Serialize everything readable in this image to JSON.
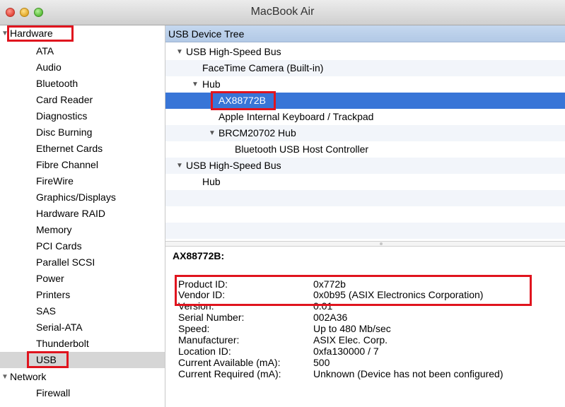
{
  "window": {
    "title": "MacBook Air"
  },
  "sidebar": {
    "groups": [
      {
        "label": "Hardware",
        "expanded": true
      },
      {
        "label": "Network",
        "expanded": true
      }
    ],
    "items": [
      "ATA",
      "Audio",
      "Bluetooth",
      "Card Reader",
      "Diagnostics",
      "Disc Burning",
      "Ethernet Cards",
      "Fibre Channel",
      "FireWire",
      "Graphics/Displays",
      "Hardware RAID",
      "Memory",
      "PCI Cards",
      "Parallel SCSI",
      "Power",
      "Printers",
      "SAS",
      "Serial-ATA",
      "Thunderbolt",
      "USB"
    ],
    "network_items": [
      "Firewall"
    ],
    "selected": "USB"
  },
  "tree": {
    "header": "USB Device Tree",
    "rows": [
      {
        "label": "USB High-Speed Bus",
        "expandable": true
      },
      {
        "label": "FaceTime Camera (Built-in)",
        "expandable": false
      },
      {
        "label": "Hub",
        "expandable": true
      },
      {
        "label": "AX88772B",
        "expandable": false,
        "selected": true
      },
      {
        "label": "Apple Internal Keyboard / Trackpad",
        "expandable": false
      },
      {
        "label": "BRCM20702 Hub",
        "expandable": true
      },
      {
        "label": "Bluetooth USB Host Controller",
        "expandable": false
      },
      {
        "label": "USB High-Speed Bus",
        "expandable": true
      },
      {
        "label": "Hub",
        "expandable": false
      }
    ]
  },
  "details": {
    "title": "AX88772B:",
    "fields": [
      {
        "label": "Product ID:",
        "value": "0x772b"
      },
      {
        "label": "Vendor ID:",
        "value": "0x0b95  (ASIX Electronics Corporation)"
      },
      {
        "label": "Version:",
        "value": "0.01"
      },
      {
        "label": "Serial Number:",
        "value": "002A36"
      },
      {
        "label": "Speed:",
        "value": "Up to 480 Mb/sec"
      },
      {
        "label": "Manufacturer:",
        "value": "ASIX Elec. Corp."
      },
      {
        "label": "Location ID:",
        "value": "0xfa130000 / 7"
      },
      {
        "label": "Current Available (mA):",
        "value": "500"
      },
      {
        "label": "Current Required (mA):",
        "value": "Unknown (Device has not been configured)"
      }
    ]
  },
  "colors": {
    "selection": "#3875d7",
    "highlight_box": "#e0141e",
    "header": "#b2c9e6"
  }
}
